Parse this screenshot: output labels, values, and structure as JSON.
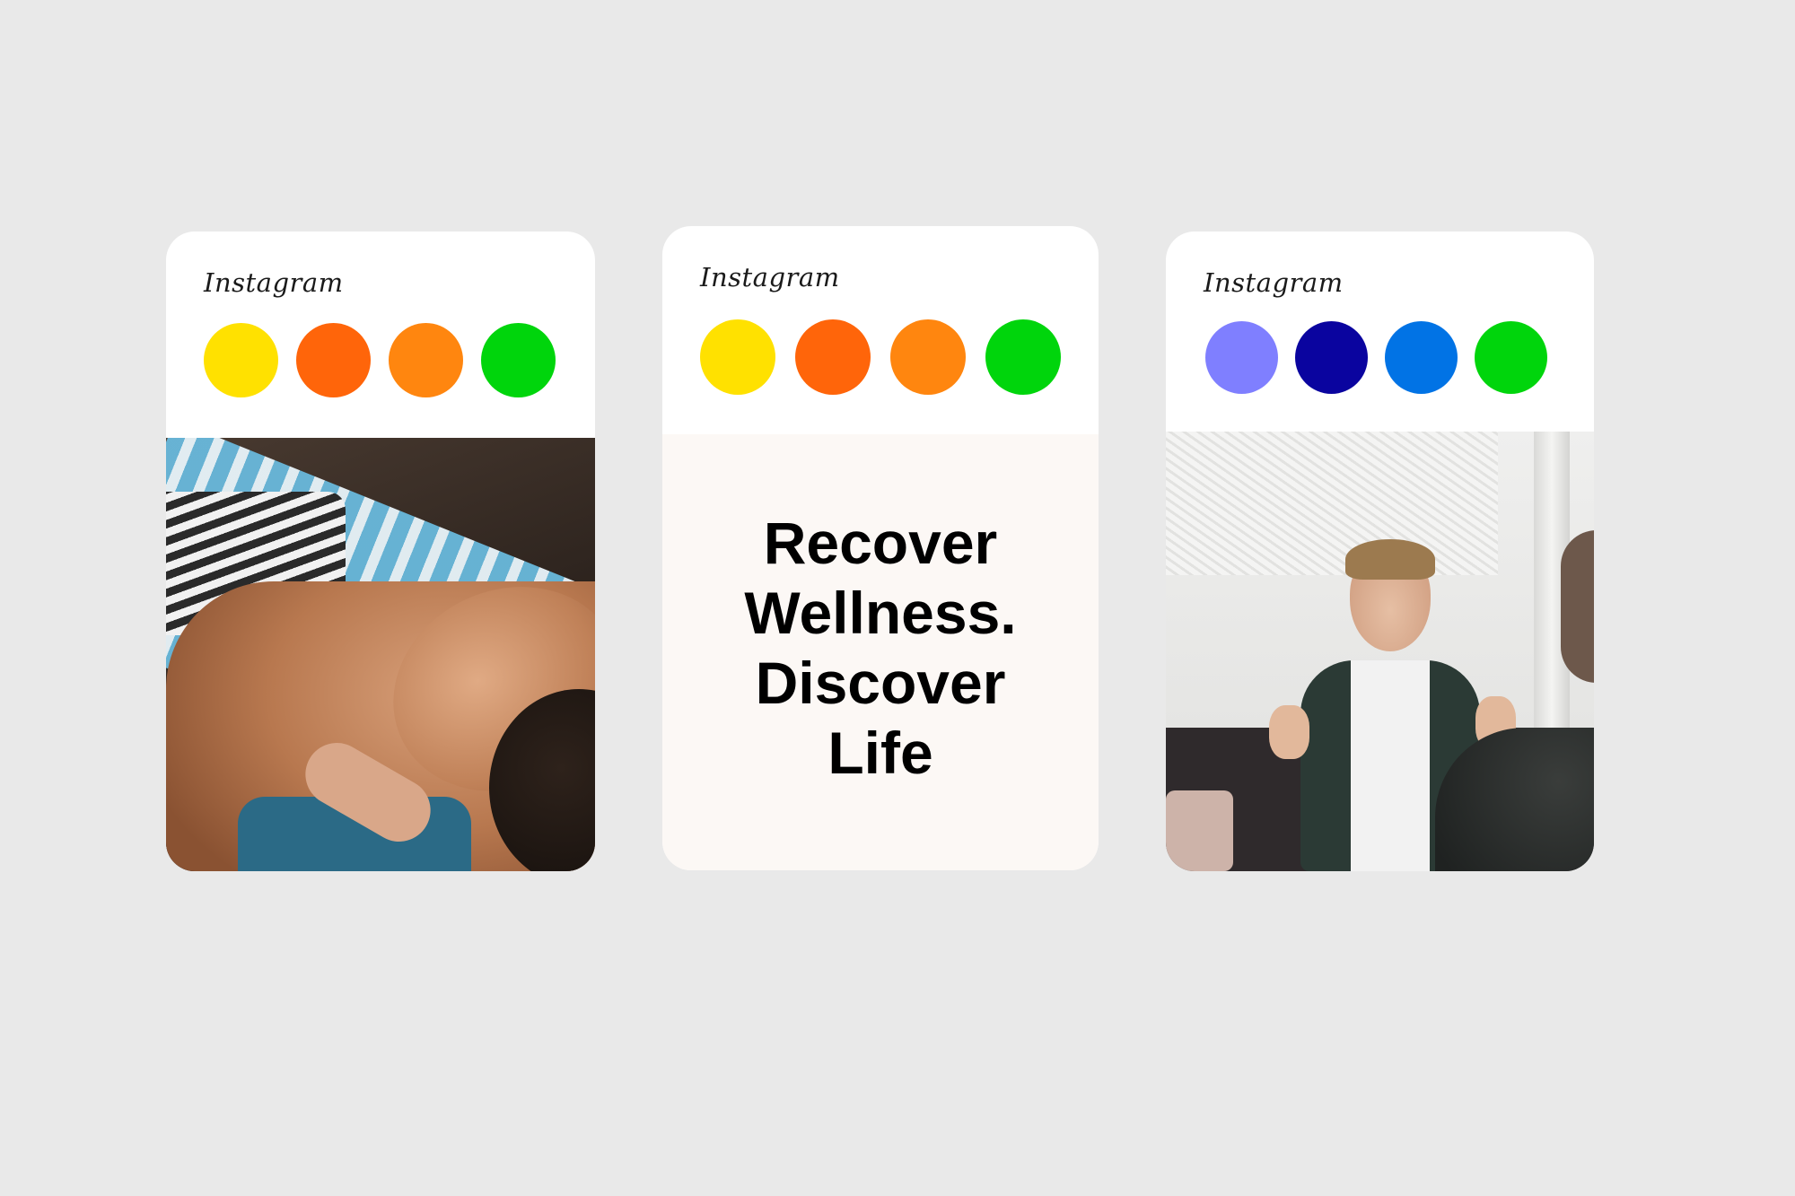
{
  "cards": [
    {
      "brand": "Instagram",
      "swatches": [
        "#FFE100",
        "#FF650A",
        "#FF860F",
        "#00D50C"
      ],
      "image": "photo of woman receiving facial massage"
    },
    {
      "brand": "Instagram",
      "swatches": [
        "#FFE100",
        "#FF650A",
        "#FF860F",
        "#00D50C"
      ],
      "headline_lines": [
        "Recover",
        "Wellness.",
        "Discover",
        "Life"
      ]
    },
    {
      "brand": "Instagram",
      "swatches": [
        "#7F7FFF",
        "#0A049F",
        "#0173E5",
        "#00D50C"
      ],
      "image": "photo of young man talking on a sofa"
    }
  ],
  "colors": {
    "background": "#E9E9E9",
    "card": "#FFFFFF",
    "text_panel": "#FCF8F5",
    "headline": "#000000"
  }
}
